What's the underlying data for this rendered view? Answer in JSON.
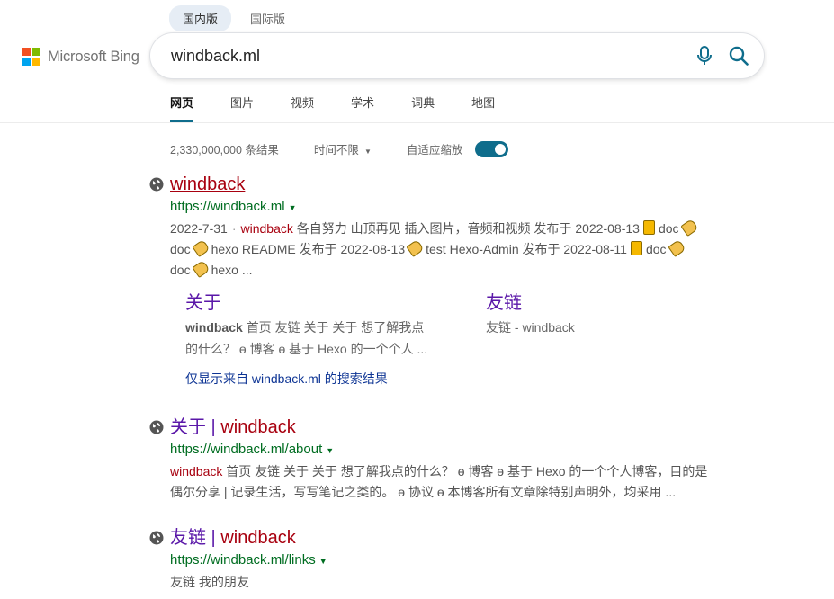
{
  "region": {
    "domestic": "国内版",
    "international": "国际版"
  },
  "logo": {
    "text": "Microsoft Bing",
    "colors": [
      "#f25022",
      "#7fba00",
      "#00a4ef",
      "#ffb900"
    ]
  },
  "search": {
    "query": "windback.ml"
  },
  "tabs": [
    "网页",
    "图片",
    "视频",
    "学术",
    "词典",
    "地图"
  ],
  "stats": {
    "count": "2,330,000,000 条结果",
    "time_filter": "时间不限",
    "adaptive_zoom": "自适应缩放",
    "adaptive_zoom_on": true
  },
  "accent": "#0f6d8c",
  "results": [
    {
      "title": "windback",
      "url": "https://windback.ml",
      "snippet": {
        "date": "2022-7-31",
        "hl": "windback",
        "line1": "各自努力 山顶再见 插入图片，音频和视频 发布于 2022-08-13",
        "doc1": "doc",
        "doc2": "doc",
        "line2a": "hexo README 发布于 2022-08-13",
        "line2b": "test Hexo-Admin 发布于 2022-08-11",
        "doc3": "doc",
        "doc4": "doc",
        "line3": "hexo ..."
      },
      "deeplinks": [
        {
          "title": "关于",
          "desc_bold": "windback",
          "desc1": "首页 友链 关于 关于 想了解我点",
          "desc2": "的什么？ ɵ 博客 ɵ 基于 Hexo 的一个个人 ..."
        },
        {
          "title": "友链",
          "desc1": "友链 - windback"
        }
      ],
      "site_only": "仅显示来自 windback.ml 的搜索结果"
    },
    {
      "title_a": "关于",
      "title_sep": " | ",
      "title_b": "windback",
      "url": "https://windback.ml/about",
      "snippet_hl": "windback",
      "snippet1": "首页 友链 关于 关于 想了解我点的什么？ ɵ 博客 ɵ 基于 Hexo 的一个个人博客，目的是",
      "snippet2": "偶尔分享 | 记录生活，写写笔记之类的。 ɵ 协议 ɵ 本博客所有文章除特别声明外，均采用 ..."
    },
    {
      "title_a": "友链",
      "title_sep": " | ",
      "title_b": "windback",
      "url": "https://windback.ml/links",
      "snippet1": "友链 我的朋友"
    }
  ]
}
